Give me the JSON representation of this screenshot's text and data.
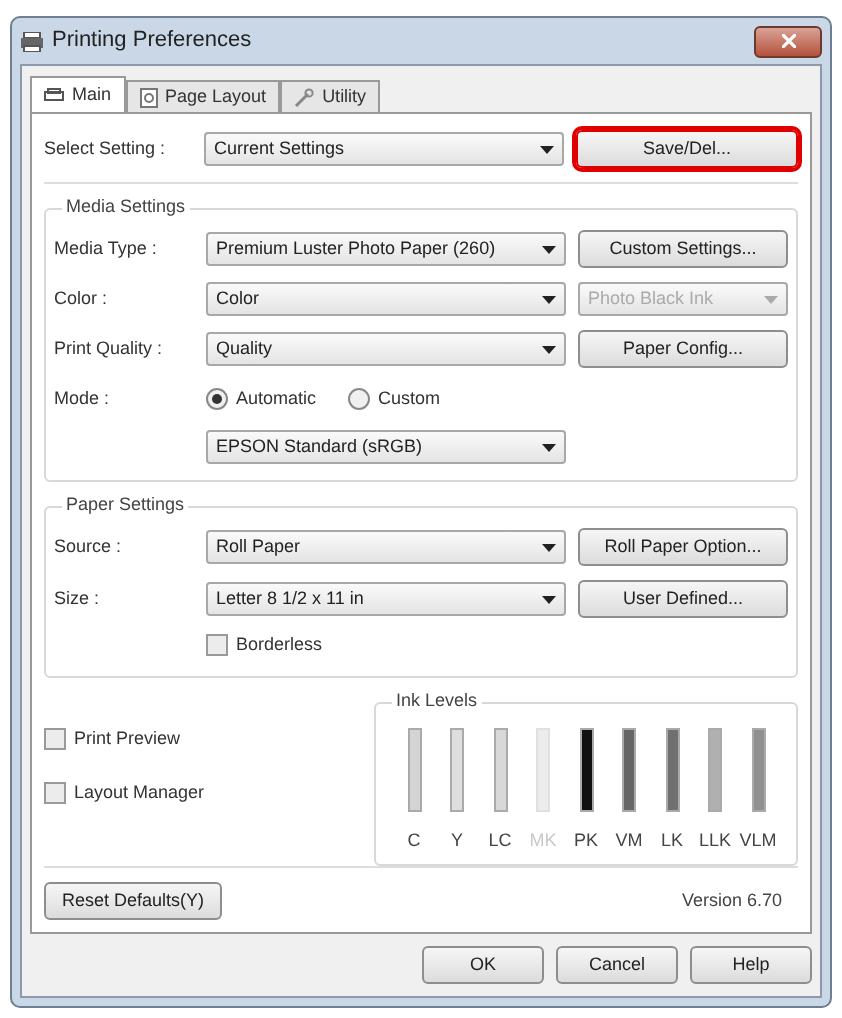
{
  "window": {
    "title": "Printing Preferences"
  },
  "tabs": [
    {
      "label": "Main",
      "selected": true
    },
    {
      "label": "Page Layout",
      "selected": false
    },
    {
      "label": "Utility",
      "selected": false
    }
  ],
  "select_setting": {
    "label": "Select Setting :",
    "value": "Current Settings",
    "button": {
      "label": "Save/Del...",
      "highlighted": true
    }
  },
  "media_settings": {
    "title": "Media Settings",
    "rows": [
      {
        "kind": "select",
        "label": "Media Type :",
        "value": "Premium Luster Photo Paper (260)",
        "side": {
          "kind": "button",
          "label": "Custom Settings..."
        }
      },
      {
        "kind": "select",
        "label": "Color :",
        "value": "Color",
        "side": {
          "kind": "select",
          "value": "Photo Black Ink",
          "disabled": true
        }
      },
      {
        "kind": "select",
        "label": "Print Quality :",
        "value": "Quality",
        "side": {
          "kind": "button",
          "label": "Paper Config..."
        }
      },
      {
        "kind": "radio",
        "label": "Mode :",
        "options": [
          {
            "label": "Automatic",
            "selected": true
          },
          {
            "label": "Custom",
            "selected": false
          }
        ]
      },
      {
        "kind": "select",
        "value": "EPSON Standard (sRGB)"
      }
    ]
  },
  "paper_settings": {
    "title": "Paper Settings",
    "rows": [
      {
        "kind": "select",
        "label": "Source :",
        "value": "Roll Paper",
        "side": {
          "kind": "button",
          "label": "Roll Paper Option..."
        }
      },
      {
        "kind": "select",
        "label": "Size :",
        "value": "Letter 8 1/2 x 11 in",
        "side": {
          "kind": "button",
          "label": "User Defined..."
        }
      },
      {
        "kind": "checkbox",
        "label": "Borderless",
        "checked": false
      }
    ]
  },
  "options": [
    {
      "label": "Print Preview",
      "checked": false
    },
    {
      "label": "Layout Manager",
      "checked": false
    }
  ],
  "ink_levels": {
    "title": "Ink Levels",
    "inks": [
      {
        "label": "C",
        "color": "#d4d4d4",
        "disabled": false
      },
      {
        "label": "Y",
        "color": "#dedede",
        "disabled": false
      },
      {
        "label": "LC",
        "color": "#d8d8d8",
        "disabled": false
      },
      {
        "label": "MK",
        "color": "#ececec",
        "disabled": true
      },
      {
        "label": "PK",
        "color": "#111111",
        "disabled": false
      },
      {
        "label": "VM",
        "color": "#666666",
        "disabled": false
      },
      {
        "label": "LK",
        "color": "#707070",
        "disabled": false
      },
      {
        "label": "LLK",
        "color": "#b0b0b0",
        "disabled": false
      },
      {
        "label": "VLM",
        "color": "#909090",
        "disabled": false
      }
    ]
  },
  "reset_button": "Reset Defaults(Y)",
  "version": "Version 6.70",
  "buttons": [
    "OK",
    "Cancel",
    "Help"
  ]
}
